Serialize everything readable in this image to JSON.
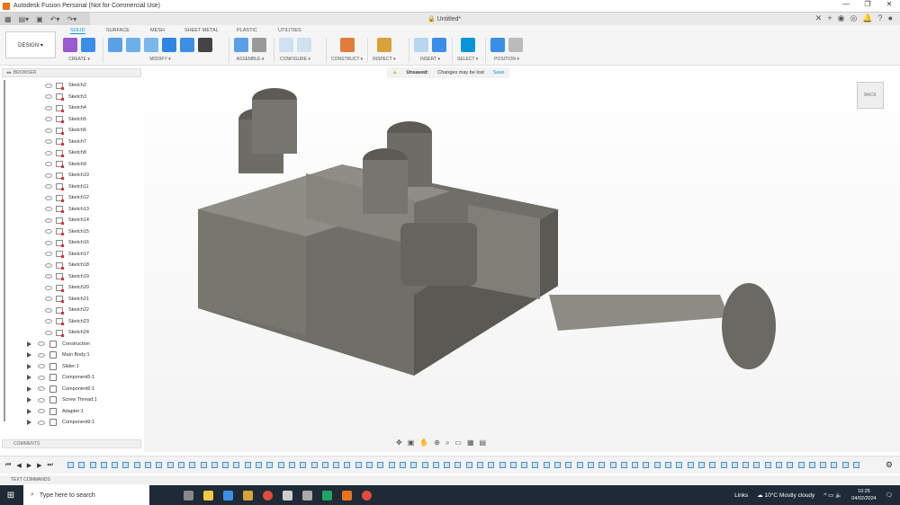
{
  "window": {
    "title": "Autodesk Fusion Personal (Not for Commercial Use)",
    "controls": [
      "—",
      "❐",
      "✕"
    ]
  },
  "document": {
    "tab_title": "Untitled*"
  },
  "ribbon": {
    "workspace": "DESIGN ▾",
    "tabs": [
      "SOLID",
      "SURFACE",
      "MESH",
      "SHEET METAL",
      "PLASTIC",
      "UTILITIES"
    ],
    "active_tab": "SOLID",
    "groups": [
      {
        "label": "CREATE ▾",
        "colors": [
          "#9b59d0",
          "#3a8ee6"
        ]
      },
      {
        "label": "MODIFY ▾",
        "colors": [
          "#5aa0e6",
          "#6bb0ea",
          "#7ab7ea",
          "#2f86e0",
          "#3d8fe4",
          "#444"
        ]
      },
      {
        "label": "ASSEMBLE ▾",
        "colors": [
          "#5aa0e6",
          "#999"
        ]
      },
      {
        "label": "CONFIGURE ▾",
        "colors": [
          "#cfe0ef",
          "#cfe0ef"
        ]
      },
      {
        "label": "CONSTRUCT ▾",
        "colors": [
          "#e27c3c"
        ]
      },
      {
        "label": "INSPECT ▾",
        "colors": [
          "#d9a13a"
        ]
      },
      {
        "label": "INSERT ▾",
        "colors": [
          "#b8d6ee",
          "#3a8ee6"
        ]
      },
      {
        "label": "SELECT ▾",
        "colors": [
          "#0696d7"
        ]
      },
      {
        "label": "POSITION ▾",
        "colors": [
          "#3a8ee6",
          "#bbb"
        ]
      }
    ]
  },
  "browser": {
    "title": "BROWSER",
    "sketches": [
      "Sketch2",
      "Sketch3",
      "Sketch4",
      "Sketch5",
      "Sketch6",
      "Sketch7",
      "Sketch8",
      "Sketch9",
      "Sketch10",
      "Sketch11",
      "Sketch12",
      "Sketch13",
      "Sketch14",
      "Sketch15",
      "Sketch16",
      "Sketch17",
      "Sketch18",
      "Sketch19",
      "Sketch20",
      "Sketch21",
      "Sketch22",
      "Sketch23",
      "Sketch24"
    ],
    "components": [
      "Construction",
      "Main Body:1",
      "Slider:1",
      "Component5:1",
      "Component6:1",
      "Screw Thread:1",
      "Adapter:1",
      "Component9:1"
    ]
  },
  "notice": {
    "label": "Unsaved:",
    "message": "Changes may be lost",
    "action": "Save"
  },
  "viewcube": {
    "face": "BACK"
  },
  "comments": {
    "title": "COMMENTS"
  },
  "text_commands": {
    "title": "TEXT COMMANDS"
  },
  "taskbar": {
    "search_placeholder": "Type here to search",
    "links": "Links",
    "weather_temp": "10°C",
    "weather_desc": "Mostly cloudy",
    "time": "10:25",
    "date": "04/02/2024"
  },
  "colors": {
    "accent": "#0696d7",
    "model": "#6f6e68",
    "taskbar": "#1f2a36"
  }
}
